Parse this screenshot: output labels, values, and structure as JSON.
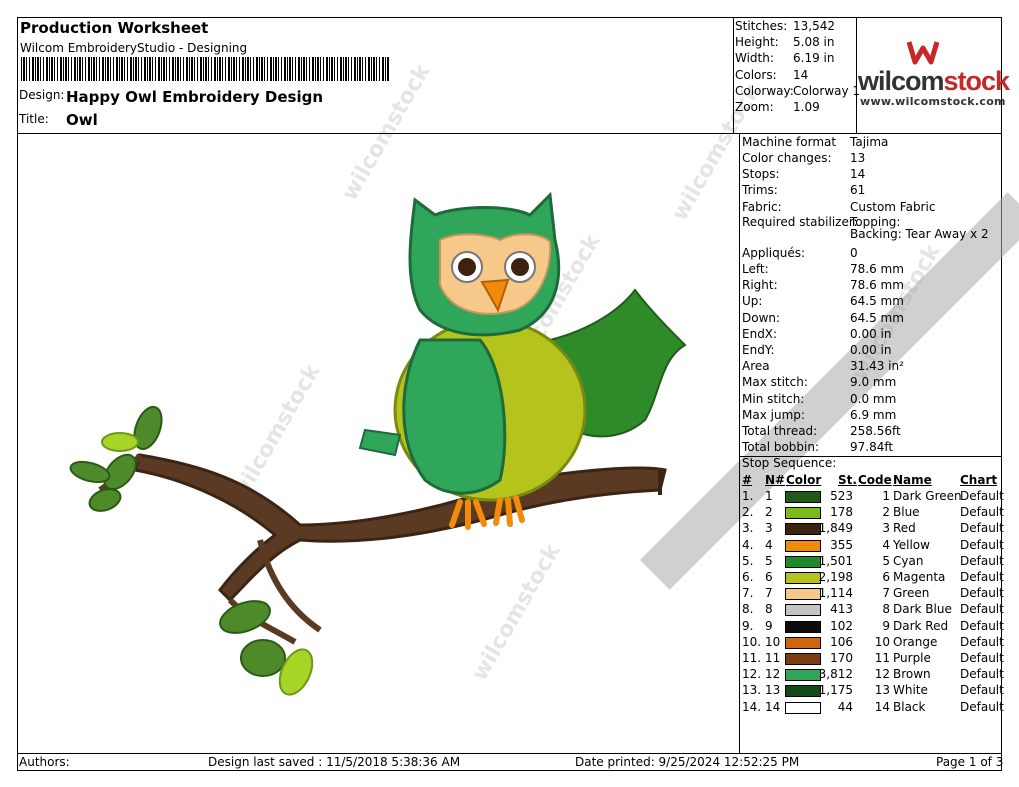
{
  "header": {
    "title": "Production Worksheet",
    "subtitle": "Wilcom EmbroideryStudio - Designing",
    "design_label": "Design:",
    "design_value": "Happy Owl Embroidery Design",
    "title_label": "Title:",
    "title_value": "Owl"
  },
  "summary": [
    {
      "label": "Stitches:",
      "value": "13,542"
    },
    {
      "label": "Height:",
      "value": "5.08 in"
    },
    {
      "label": "Width:",
      "value": "6.19 in"
    },
    {
      "label": "Colors:",
      "value": "14"
    },
    {
      "label": "Colorway:",
      "value": "Colorway 1"
    },
    {
      "label": "Zoom:",
      "value": "1.09"
    }
  ],
  "logo": {
    "brand_a": "wilcom",
    "brand_b": "stock",
    "url": "www.wilcomstock.com"
  },
  "details": [
    {
      "label": "Machine format",
      "value": "Tajima"
    },
    {
      "label": "Color changes:",
      "value": "13"
    },
    {
      "label": "Stops:",
      "value": "14"
    },
    {
      "label": "Trims:",
      "value": "61"
    },
    {
      "label": "Fabric:",
      "value": "Custom Fabric"
    },
    {
      "label": "Required stabilizer:",
      "value": "Topping:"
    },
    {
      "label": "",
      "value": "Backing: Tear Away x 2"
    },
    {
      "label": "Appliqués:",
      "value": "0"
    },
    {
      "label": "Left:",
      "value": "78.6 mm"
    },
    {
      "label": "Right:",
      "value": "78.6 mm"
    },
    {
      "label": "Up:",
      "value": "64.5 mm"
    },
    {
      "label": "Down:",
      "value": "64.5 mm"
    },
    {
      "label": "EndX:",
      "value": "0.00 in"
    },
    {
      "label": "EndY:",
      "value": "0.00 in"
    },
    {
      "label": "Area",
      "value": "31.43 in²"
    },
    {
      "label": "Max stitch:",
      "value": "9.0 mm"
    },
    {
      "label": "Min stitch:",
      "value": "0.0 mm"
    },
    {
      "label": "Max jump:",
      "value": "6.9 mm"
    },
    {
      "label": "Total thread:",
      "value": "258.56ft"
    },
    {
      "label": "Total bobbin:",
      "value": "97.84ft"
    }
  ],
  "stops": {
    "heading": "Stop Sequence:",
    "columns": {
      "idx": "#",
      "n": "N#",
      "color": "Color",
      "st": "St.",
      "code": "Code",
      "name": "Name",
      "chart": "Chart"
    },
    "rows": [
      {
        "idx": "1.",
        "n": "1",
        "swatch": "#1f5a1a",
        "st": "523",
        "code": "1",
        "name": "Dark Green",
        "chart": "Default"
      },
      {
        "idx": "2.",
        "n": "2",
        "swatch": "#7aba1c",
        "st": "178",
        "code": "2",
        "name": "Blue",
        "chart": "Default"
      },
      {
        "idx": "3.",
        "n": "3",
        "swatch": "#3c2310",
        "st": "1,849",
        "code": "3",
        "name": "Red",
        "chart": "Default"
      },
      {
        "idx": "4.",
        "n": "4",
        "swatch": "#f28a0c",
        "st": "355",
        "code": "4",
        "name": "Yellow",
        "chart": "Default"
      },
      {
        "idx": "5.",
        "n": "5",
        "swatch": "#1f8a28",
        "st": "1,501",
        "code": "5",
        "name": "Cyan",
        "chart": "Default"
      },
      {
        "idx": "6.",
        "n": "6",
        "swatch": "#b5c41c",
        "st": "2,198",
        "code": "6",
        "name": "Magenta",
        "chart": "Default"
      },
      {
        "idx": "7.",
        "n": "7",
        "swatch": "#f6c88a",
        "st": "1,114",
        "code": "7",
        "name": "Green",
        "chart": "Default"
      },
      {
        "idx": "8.",
        "n": "8",
        "swatch": "#c4c4c4",
        "st": "413",
        "code": "8",
        "name": "Dark Blue",
        "chart": "Default"
      },
      {
        "idx": "9.",
        "n": "9",
        "swatch": "#0c0c0c",
        "st": "102",
        "code": "9",
        "name": "Dark Red",
        "chart": "Default"
      },
      {
        "idx": "10.",
        "n": "10",
        "swatch": "#cf6510",
        "st": "106",
        "code": "10",
        "name": "Orange",
        "chart": "Default"
      },
      {
        "idx": "11.",
        "n": "11",
        "swatch": "#7a3d12",
        "st": "170",
        "code": "11",
        "name": "Purple",
        "chart": "Default"
      },
      {
        "idx": "12.",
        "n": "12",
        "swatch": "#2fa65a",
        "st": "3,812",
        "code": "12",
        "name": "Brown",
        "chart": "Default"
      },
      {
        "idx": "13.",
        "n": "13",
        "swatch": "#124a16",
        "st": "1,175",
        "code": "13",
        "name": "White",
        "chart": "Default"
      },
      {
        "idx": "14.",
        "n": "14",
        "swatch": "#ffffff",
        "st": "44",
        "code": "14",
        "name": "Black",
        "chart": "Default"
      }
    ]
  },
  "footer": {
    "authors": "Authors:",
    "saved": "Design last saved : 11/5/2018 5:38:36 AM",
    "printed": "Date printed: 9/25/2024 12:52:25 PM",
    "page": "Page 1 of 3"
  },
  "watermark_text": "wilcomstock"
}
